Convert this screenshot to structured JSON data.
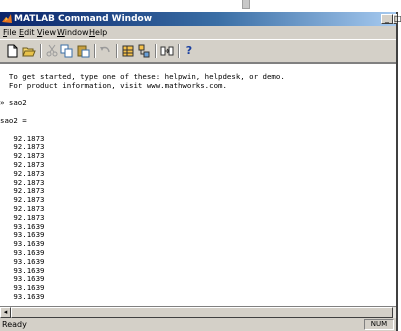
{
  "window": {
    "title": "MATLAB Command Window",
    "min_button": "_",
    "max_button": "□"
  },
  "menu": {
    "file": {
      "underlined": "F",
      "rest": "ile"
    },
    "edit": {
      "underlined": "E",
      "rest": "dit"
    },
    "view": {
      "underlined": "V",
      "rest": "iew"
    },
    "window": {
      "underlined": "W",
      "rest": "indow"
    },
    "help": {
      "underlined": "H",
      "rest": "elp"
    }
  },
  "toolbar": {
    "new_icon": "new-document-icon",
    "open_icon": "open-folder-icon",
    "cut_icon": "cut-icon",
    "copy_icon": "copy-icon",
    "paste_icon": "paste-icon",
    "undo_icon": "undo-icon",
    "workspace_icon": "workspace-browser-icon",
    "path_icon": "path-browser-icon",
    "simulink_icon": "simulink-icon",
    "help_label": "?"
  },
  "console": {
    "lines": [
      "  To get started, type one of these: helpwin, helpdesk, or demo.",
      "  For product information, visit www.mathworks.com.",
      "",
      "» sao2",
      "",
      "sao2 =",
      "",
      "   92.1873",
      "   92.1873",
      "   92.1873",
      "   92.1873",
      "   92.1873",
      "   92.1873",
      "   92.1873",
      "   92.1873",
      "   92.1873",
      "   92.1873",
      "   93.1639",
      "   93.1639",
      "   93.1639",
      "   93.1639",
      "   93.1639",
      "   93.1639",
      "   93.1639",
      "   93.1639",
      "   93.1639"
    ]
  },
  "scroll": {
    "left_arrow": "◂"
  },
  "status": {
    "text": "Ready",
    "num": "NUM"
  },
  "colors": {
    "title_start": "#0a246a",
    "title_end": "#a6caf0",
    "chrome": "#d4d0c8"
  }
}
